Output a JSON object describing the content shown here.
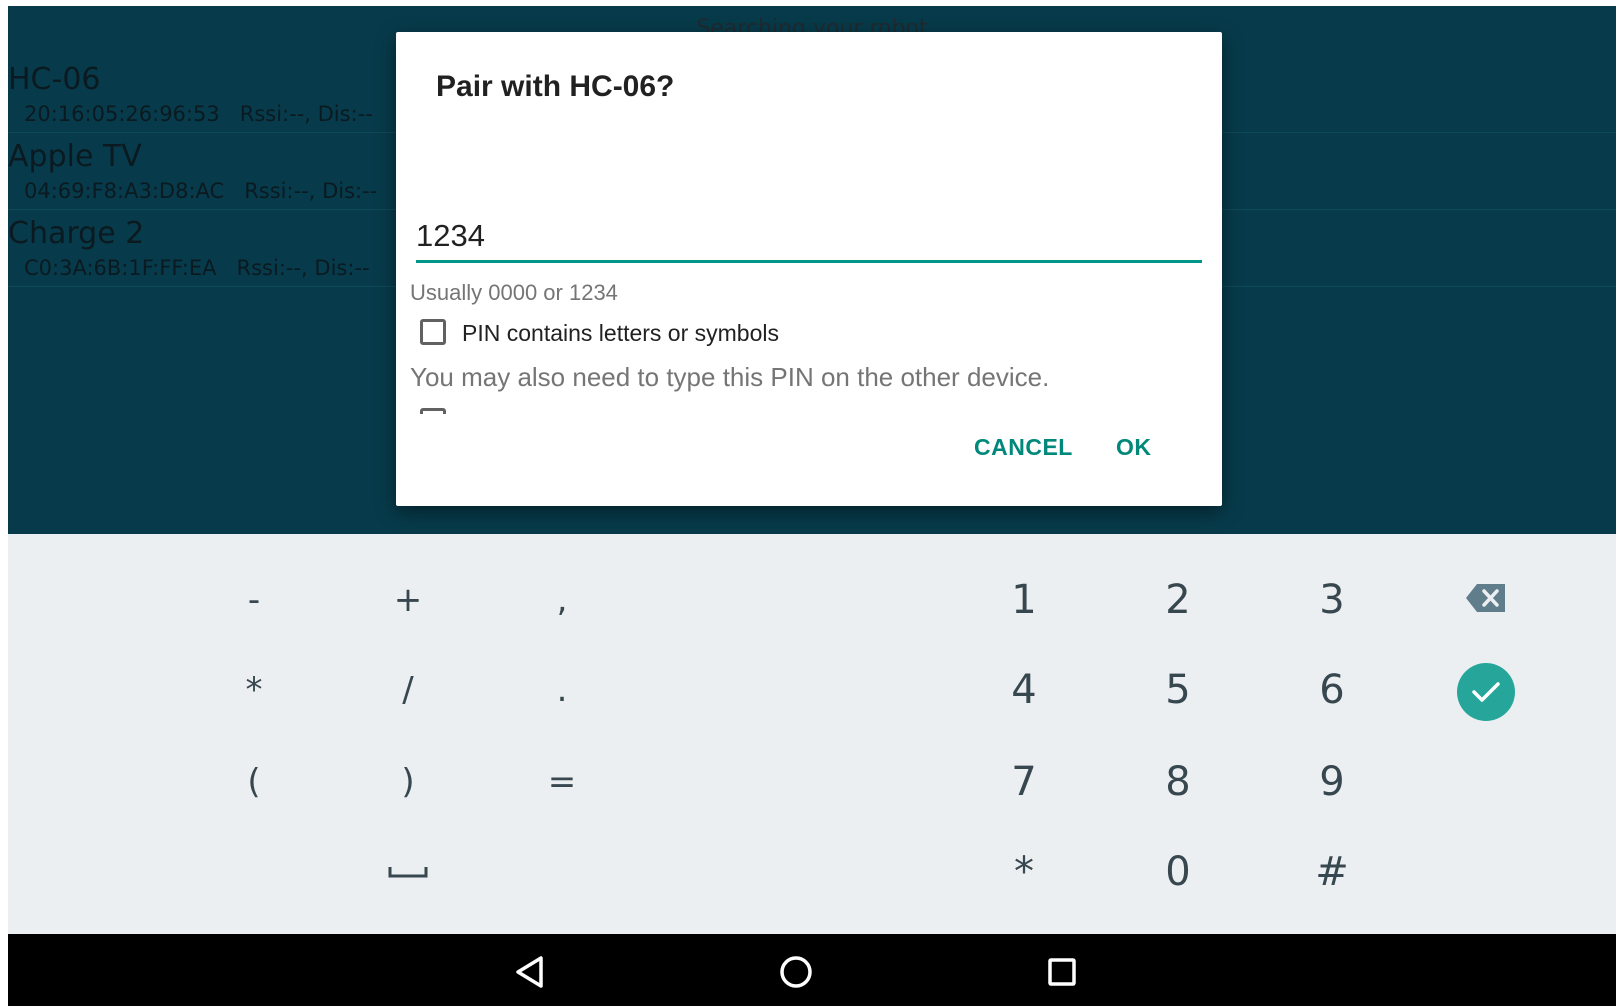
{
  "app": {
    "status_text": "Searching your robot",
    "devices": [
      {
        "name": "HC-06",
        "info": "20:16:05:26:96:53   Rssi:--, Dis:--"
      },
      {
        "name": "Apple TV",
        "info": "04:69:F8:A3:D8:AC   Rssi:--, Dis:--"
      },
      {
        "name": "Charge 2",
        "info": "C0:3A:6B:1F:FF:EA   Rssi:--, Dis:--"
      }
    ]
  },
  "dialog": {
    "title": "Pair with HC-06?",
    "pin_value": "1234",
    "hint": "Usually 0000 or 1234",
    "checkbox_label": "PIN contains letters or symbols",
    "checkbox_checked": false,
    "note": "You may also need to type this PIN on the other device.",
    "cancel_label": "CANCEL",
    "ok_label": "OK",
    "accent_color": "#009688"
  },
  "keyboard": {
    "symbol_keys": [
      [
        "-",
        "+",
        ","
      ],
      [
        "*",
        "/",
        "."
      ],
      [
        "(",
        ")",
        "="
      ]
    ],
    "space_key_icon": "space-bar-icon",
    "digit_keys": [
      [
        "1",
        "2",
        "3"
      ],
      [
        "4",
        "5",
        "6"
      ],
      [
        "7",
        "8",
        "9"
      ],
      [
        "*",
        "0",
        "#"
      ]
    ],
    "backspace_icon": "backspace-icon",
    "enter_icon": "checkmark-icon",
    "enter_color": "#26a69a"
  },
  "navbar": {
    "back_icon": "back-triangle-icon",
    "home_icon": "home-circle-icon",
    "recents_icon": "recents-square-icon"
  }
}
